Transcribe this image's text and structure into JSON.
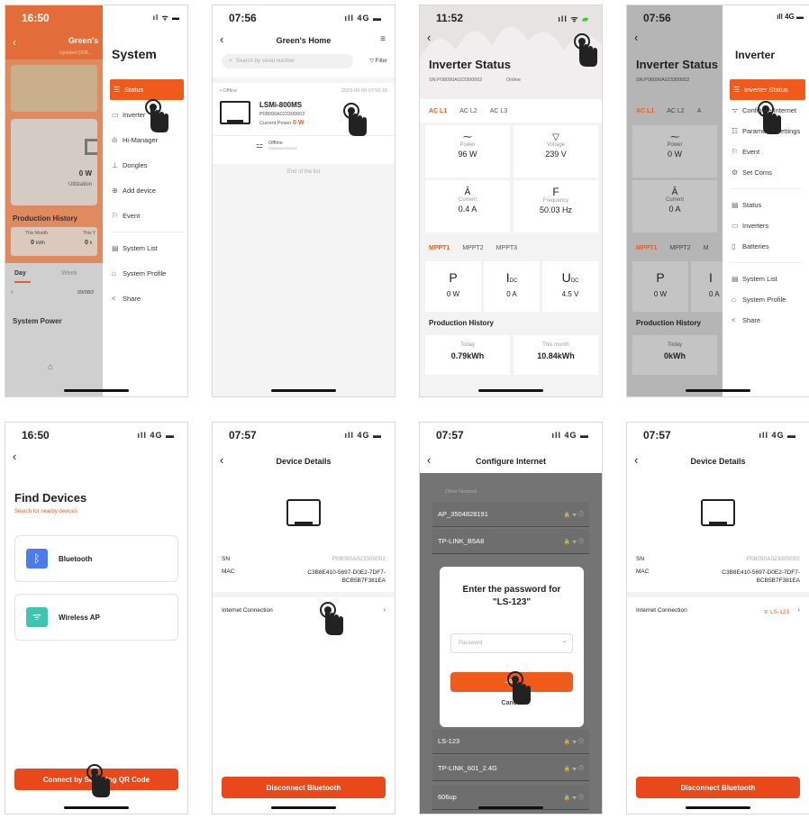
{
  "status_bar": {
    "time_1": "16:50",
    "time_2": "07:56",
    "time_3": "11:52",
    "time_4": "07:56",
    "time_5": "16:50",
    "time_6": "07:57",
    "time_7": "07:57",
    "time_8": "07:57",
    "signal_4g": "4G"
  },
  "screen1": {
    "home_title": "Green's",
    "updated": "Updated (0/08...",
    "value": "0 W",
    "utilization": "Utilization",
    "prod_history": "Production History",
    "this_month": "This Month",
    "this_month_val": "0",
    "this_month_unit": "kWh",
    "this_year": "This Y",
    "this_year_val": "0",
    "this_year_unit": "k",
    "tab_day": "Day",
    "tab_week": "Week",
    "date": "09/08/2",
    "system_power": "System Power",
    "panel_title": "System",
    "menu": [
      {
        "label": "Status",
        "icon": "☰"
      },
      {
        "label": "Inverter",
        "icon": "▭"
      },
      {
        "label": "Hi-Manager",
        "icon": "ılı"
      },
      {
        "label": "Dongles",
        "icon": "⊥"
      },
      {
        "label": "Add device",
        "icon": "⊕"
      },
      {
        "label": "Event",
        "icon": "⚐"
      },
      {
        "label": "System List",
        "icon": "▤"
      },
      {
        "label": "System Profile",
        "icon": "⌂"
      },
      {
        "label": "Share",
        "icon": "<"
      }
    ]
  },
  "screen2": {
    "title": "Green's Home",
    "search_placeholder": "Search by serial number",
    "filter": "Filter",
    "status": "• Offline",
    "timestamp": "2023-09-09 07:56:18",
    "device_name": "LSMi-800MS",
    "serial": "P08090A023300002",
    "current_power_label": "Current Power",
    "current_power_value": "0 W",
    "sub_status": "Offline",
    "sub_serial": "P08090A023300002",
    "end": "End of the list"
  },
  "screen3": {
    "title": "Inverter Status",
    "sn": "SN:P08090A023300002",
    "online": "Online",
    "ac_tabs": [
      "AC L1",
      "AC L2",
      "AC L3"
    ],
    "power_label": "Power",
    "power_value": "96 W",
    "voltage_label": "Voltage",
    "voltage_value": "239 V",
    "current_label": "Current",
    "current_value": "0.4 A",
    "frequency_label": "Frequency",
    "frequency_value": "50.03 Hz",
    "freq_symbol": "F",
    "mppt_tabs": [
      "MPPT1",
      "MPPT2",
      "MPPT3"
    ],
    "p_symbol": "P",
    "p_value": "0 W",
    "idc_symbol": "I",
    "idc_sub": "DC",
    "idc_value": "0 A",
    "udc_symbol": "U",
    "udc_sub": "DC",
    "udc_value": "4.5 V",
    "prod_history": "Production History",
    "today_label": "Today",
    "today_value": "0.79kWh",
    "month_label": "This month",
    "month_value": "10.84kWh"
  },
  "screen4": {
    "title": "Inverter Status",
    "sn": "SN:P08090A023300002",
    "ac_tabs": [
      "AC L1",
      "AC L2",
      "A"
    ],
    "power_label": "Power",
    "power_value": "0 W",
    "current_label": "Current",
    "current_value": "0 A",
    "mppt_tabs": [
      "MPPT1",
      "MPPT2",
      "M"
    ],
    "p_value": "0 W",
    "idc_value": "0 A",
    "prod_history": "Production History",
    "today_label": "Today",
    "today_value": "0kWh",
    "panel_title": "Inverter",
    "menu": [
      {
        "label": "Inverter Status",
        "icon": "☰"
      },
      {
        "label": "Configure Internet",
        "icon": "ᯤ"
      },
      {
        "label": "Parameter Settings",
        "icon": "☷"
      },
      {
        "label": "Event",
        "icon": "⚐"
      },
      {
        "label": "Set Coms",
        "icon": "⚙"
      },
      {
        "label": "Status",
        "icon": "▤"
      },
      {
        "label": "Inverters",
        "icon": "▭"
      },
      {
        "label": "Batteries",
        "icon": "▯"
      },
      {
        "label": "System List",
        "icon": "▤"
      },
      {
        "label": "System Profile",
        "icon": "⌂"
      },
      {
        "label": "Share",
        "icon": "<"
      }
    ]
  },
  "screen5": {
    "title": "Find Devices",
    "subtitle": "Search for nearby devices",
    "bluetooth": "Bluetooth",
    "wireless_ap": "Wireless AP",
    "qr_button": "Connect by Scanning QR Code"
  },
  "screen6": {
    "title": "Device Details",
    "sn_label": "SN",
    "sn_value": "P08090A023300002",
    "mac_label": "MAC",
    "mac_value_1": "C3B8E410-5697-D0E2-7DF7-",
    "mac_value_2": "BCB5B7F381EA",
    "internet_label": "Internet Connection",
    "disconnect": "Disconnect Bluetooth"
  },
  "screen7": {
    "title": "Configure Internet",
    "other_network": "Other Network",
    "networks_top": [
      "AP_3504828191",
      "TP-LINK_B5A8"
    ],
    "networks_bottom": [
      "LS-123",
      "TP-LINK_601_2.4G",
      "606up"
    ],
    "dialog_title_1": "Enter the password for",
    "dialog_title_2": "\"LS-123\"",
    "password_placeholder": "Password",
    "join": "Join",
    "cancel": "Cancel"
  },
  "screen8": {
    "title": "Device Details",
    "sn_label": "SN",
    "sn_value": "P08090A023300002",
    "mac_label": "MAC",
    "mac_value_1": "C3B8E410-5697-D0E2-7DF7-",
    "mac_value_2": "BCB5B7F381EA",
    "internet_label": "Internet Connection",
    "internet_value": "LS-123",
    "disconnect": "Disconnect Bluetooth"
  },
  "colors": {
    "accent": "#f05a1a",
    "button": "#e9481a",
    "bluetooth": "#4b7bec",
    "wifi": "#3cc5b0"
  }
}
